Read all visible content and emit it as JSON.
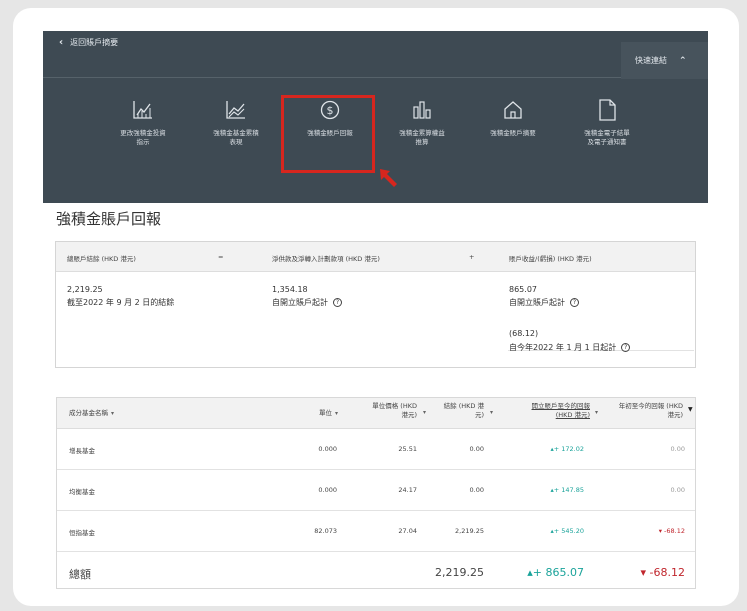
{
  "nav": {
    "back_label": "返回賬戶摘要",
    "quick_links_label": "快速連結",
    "items": [
      {
        "label": "更改強積金投資\n指示",
        "icon": "chart-line-icon"
      },
      {
        "label": "強積金基金累積\n表現",
        "icon": "trend-chart-icon"
      },
      {
        "label": "強積金賬戶回報",
        "icon": "dollar-circle-icon"
      },
      {
        "label": "強積金累算權益\n推算",
        "icon": "bar-chart-icon"
      },
      {
        "label": "強積金賬戶摘要",
        "icon": "home-icon"
      },
      {
        "label": "強積金電子結單\n及電子通知書",
        "icon": "document-icon"
      }
    ],
    "highlight_color": "#d7261e"
  },
  "page_title": "強積金賬戶回報",
  "summary": {
    "col1_header": "總賬戶結餘 (HKD 港元)",
    "op1": "=",
    "col2_header": "淨供款及淨轉入計劃款項 (HKD 港元)",
    "op2": "+",
    "col3_header": "賬戶收益/(虧損) (HKD 港元)",
    "balance": "2,219.25",
    "balance_note": "截至2022 年 9 月 2 日的結餘",
    "contrib": "1,354.18",
    "contrib_note": "自開立賬戶起計",
    "gain_since_open": "865.07",
    "gain_since_open_note": "自開立賬戶起計",
    "gain_ytd": "(68.12)",
    "gain_ytd_note": "自今年2022 年 1 月 1 日起計",
    "help_glyph": "?"
  },
  "table": {
    "headers": {
      "fund": "成分基金名稱",
      "units": "單位",
      "price": "單位價格 (HKD\n港元)",
      "balance": "結餘 (HKD 港\n元)",
      "return_open": "開立賬戶至今的回報\n(HKD 港元)",
      "return_ytd": "年初至今的回報 (HKD\n港元)"
    },
    "rows": [
      {
        "fund": "增長基金",
        "units": "0.000",
        "price": "25.51",
        "balance": "0.00",
        "return_open": "+ 172.02",
        "return_ytd": "0.00"
      },
      {
        "fund": "均衡基金",
        "units": "0.000",
        "price": "24.17",
        "balance": "0.00",
        "return_open": "+ 147.85",
        "return_ytd": "0.00"
      },
      {
        "fund": "恒指基金",
        "units": "82.073",
        "price": "27.04",
        "balance": "2,219.25",
        "return_open": "+ 545.20",
        "return_ytd": "-68.12"
      }
    ],
    "total": {
      "label": "總額",
      "balance": "2,219.25",
      "return_open": "+ 865.07",
      "return_ytd": "-68.12"
    }
  },
  "colors": {
    "nav_bg": "#3e4a53",
    "gain": "#1aa39a",
    "loss": "#c0262d"
  }
}
